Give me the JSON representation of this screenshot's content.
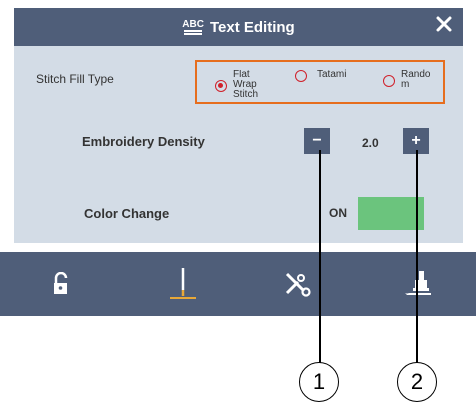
{
  "header": {
    "abc_icon_text": "ABC",
    "title": "Text Editing"
  },
  "stitch_fill": {
    "label": "Stitch Fill Type",
    "options": [
      {
        "label": "Flat\nWrap\nStitch",
        "selected": true
      },
      {
        "label": "Tatami",
        "selected": false
      },
      {
        "label": "Rando\nm",
        "selected": false
      }
    ]
  },
  "density": {
    "label": "Embroidery Density",
    "value": "2.0",
    "minus_label": "−",
    "plus_label": "+"
  },
  "color_change": {
    "label": "Color Change",
    "state": "ON"
  },
  "toolbar": {
    "items": [
      "unlock-icon",
      "needle-icon",
      "cut-icon",
      "presser-foot-icon"
    ]
  },
  "callouts": [
    "1",
    "2"
  ],
  "colors": {
    "titlebar": "#4f5e79",
    "panel": "#d3dce6",
    "highlight": "#e66e1e",
    "radio": "#d0202a",
    "toggle_on": "#6bc47d",
    "needle_accent": "#e8a838"
  }
}
